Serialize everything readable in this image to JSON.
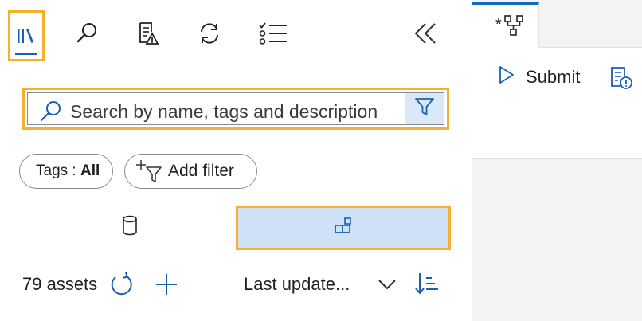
{
  "toolbar": {
    "icons": [
      "library-icon",
      "search-icon",
      "document-warning-icon",
      "refresh-icon",
      "checklist-icon",
      "collapse-icon"
    ]
  },
  "search": {
    "placeholder": "Search by name, tags and description"
  },
  "filters": {
    "tags_label": "Tags : ",
    "tags_value": "All",
    "add_filter_label": "Add filter"
  },
  "view_toggle": {
    "options": [
      "datastore-view",
      "grid-view"
    ],
    "selected": "grid-view"
  },
  "assets": {
    "count_label": "79 assets",
    "sort_label": "Last update..."
  },
  "editor": {
    "tab_marker": "*",
    "submit_label": "Submit"
  },
  "colors": {
    "highlight": "#f3b12d",
    "accent": "#1a5fb4",
    "selected_bg": "#cfe1f7"
  }
}
